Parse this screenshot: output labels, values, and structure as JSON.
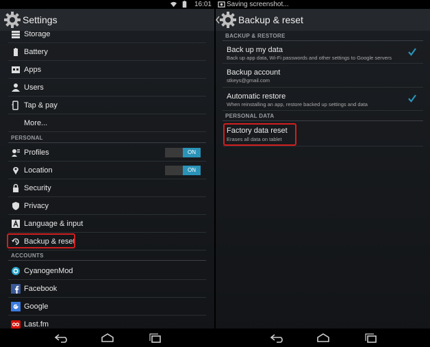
{
  "status": {
    "time": "16:01",
    "notification": "Saving screenshot..."
  },
  "left": {
    "title": "Settings",
    "items_top": [
      {
        "label": "Storage",
        "icon": "storage-icon"
      },
      {
        "label": "Battery",
        "icon": "battery-icon"
      },
      {
        "label": "Apps",
        "icon": "apps-icon"
      },
      {
        "label": "Users",
        "icon": "users-icon"
      },
      {
        "label": "Tap & pay",
        "icon": "tap-pay-icon"
      },
      {
        "label": "More...",
        "icon": ""
      }
    ],
    "section_personal": "PERSONAL",
    "items_personal": [
      {
        "label": "Profiles",
        "icon": "profiles-icon",
        "toggle": "ON"
      },
      {
        "label": "Location",
        "icon": "location-icon",
        "toggle": "ON"
      },
      {
        "label": "Security",
        "icon": "lock-icon"
      },
      {
        "label": "Privacy",
        "icon": "privacy-icon"
      },
      {
        "label": "Language & input",
        "icon": "language-icon"
      },
      {
        "label": "Backup & reset",
        "icon": "backup-icon"
      }
    ],
    "section_accounts": "ACCOUNTS",
    "items_accounts": [
      {
        "label": "CyanogenMod",
        "icon": "cyanogenmod-icon"
      },
      {
        "label": "Facebook",
        "icon": "facebook-icon"
      },
      {
        "label": "Google",
        "icon": "google-icon"
      },
      {
        "label": "Last.fm",
        "icon": "lastfm-icon"
      }
    ]
  },
  "right": {
    "title": "Backup & reset",
    "section_backup": "BACKUP & RESTORE",
    "backup_data": {
      "title": "Back up my data",
      "summary": "Back up app data, Wi-Fi passwords and other settings to Google servers"
    },
    "backup_account": {
      "title": "Backup account",
      "summary": "stkeys@gmail.com"
    },
    "auto_restore": {
      "title": "Automatic restore",
      "summary": "When reinstalling an app, restore backed up settings and data"
    },
    "section_personal": "PERSONAL DATA",
    "factory_reset": {
      "title": "Factory data reset",
      "summary": "Erases all data on tablet"
    }
  },
  "colors": {
    "accent": "#2a93b8",
    "highlight": "#d21f1f",
    "actionbar": "#25282c"
  }
}
